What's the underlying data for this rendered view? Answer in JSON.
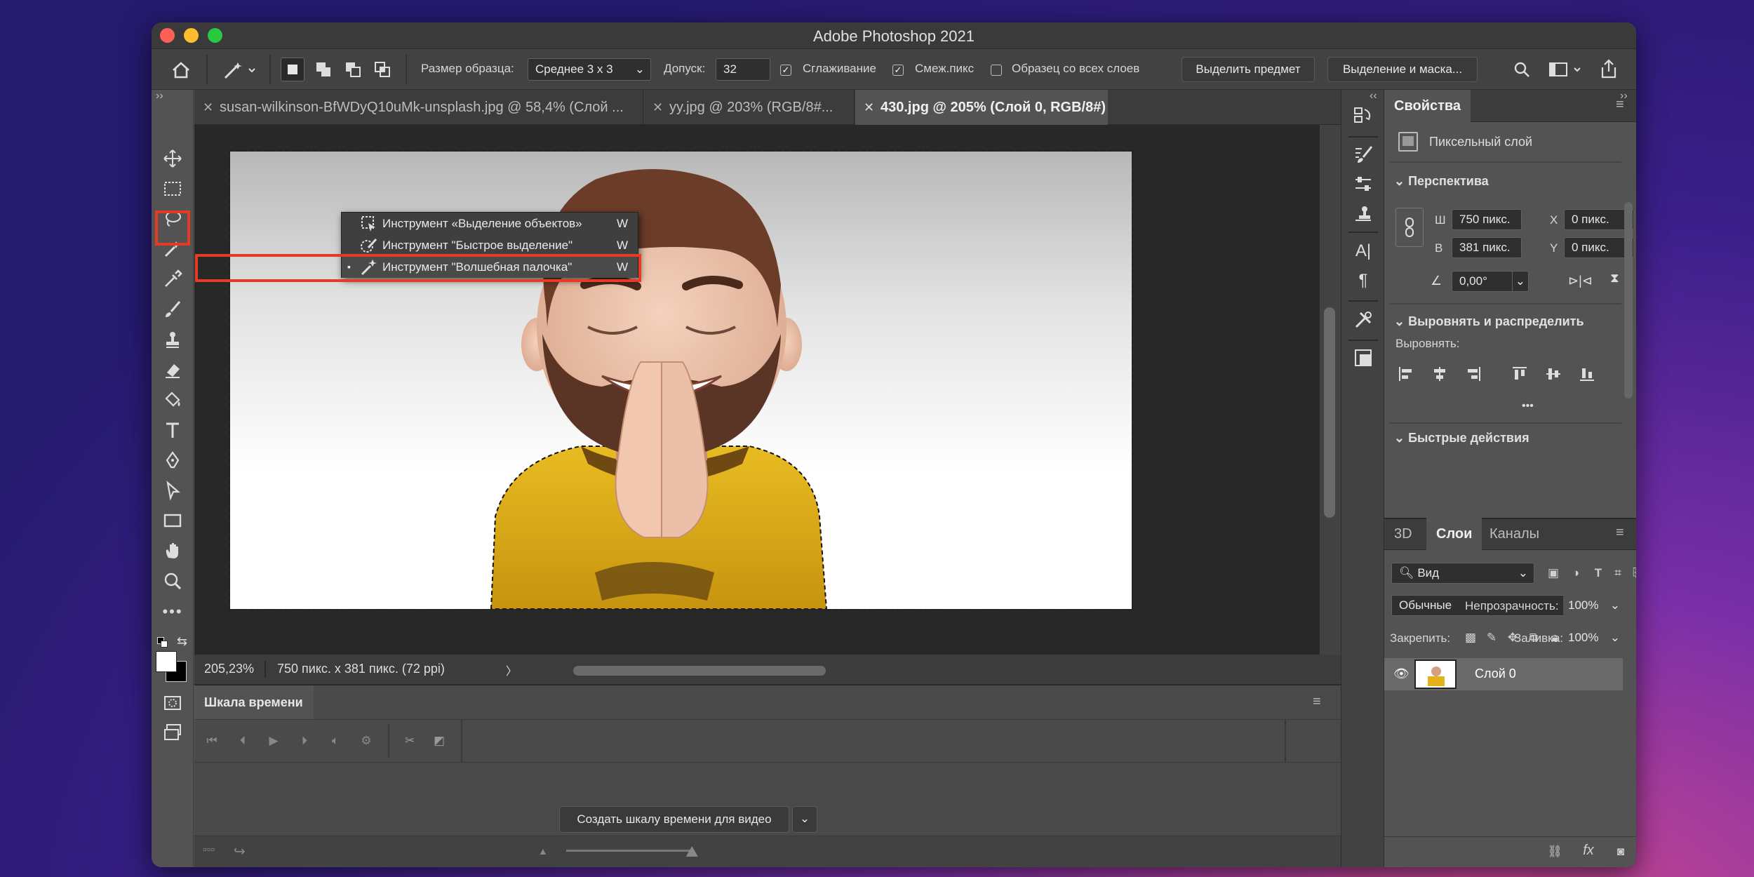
{
  "window": {
    "title": "Adobe Photoshop 2021"
  },
  "options_bar": {
    "sample_size_label": "Размер образца:",
    "sample_size_value": "Среднее 3 x 3",
    "tolerance_label": "Допуск:",
    "tolerance_value": "32",
    "anti_alias_label": "Сглаживание",
    "contiguous_label": "Смеж.пикс",
    "sample_all_label": "Образец со всех слоев",
    "select_subject": "Выделить предмет",
    "select_mask": "Выделение и маска..."
  },
  "tabs": [
    {
      "label": "susan-wilkinson-BfWDyQ10uMk-unsplash.jpg @ 58,4% (Слой ..."
    },
    {
      "label": "yy.jpg @ 203% (RGB/8#..."
    },
    {
      "label": "430.jpg @ 205% (Слой 0, RGB/8#) *"
    }
  ],
  "flyout": {
    "items": [
      {
        "label": "Инструмент «Выделение объектов»",
        "key": "W"
      },
      {
        "label": "Инструмент \"Быстрое выделение\"",
        "key": "W"
      },
      {
        "label": "Инструмент \"Волшебная палочка\"",
        "key": "W"
      }
    ]
  },
  "status": {
    "zoom": "205,23%",
    "doc_info": "750 пикс. x 381 пикс. (72 ppi)",
    "arrow": "〉"
  },
  "timeline": {
    "title": "Шкала времени",
    "create_button": "Создать шкалу времени для видео"
  },
  "properties": {
    "tab": "Свойства",
    "layer_type": "Пиксельный слой",
    "perspective": "Перспектива",
    "w_label": "Ш",
    "w_value": "750 пикс.",
    "h_label": "В",
    "h_value": "381 пикс.",
    "x_label": "X",
    "x_value": "0 пикс.",
    "y_label": "Y",
    "y_value": "0 пикс.",
    "angle_value": "0,00°",
    "align_section": "Выровнять и распределить",
    "align_label": "Выровнять:",
    "more": "•••",
    "quick_actions": "Быстрые действия"
  },
  "layers": {
    "tabs": [
      "3D",
      "Слои",
      "Каналы"
    ],
    "filter": "Вид",
    "blend_mode": "Обычные",
    "opacity_label": "Непрозрачность:",
    "opacity_value": "100%",
    "lock_label": "Закрепить:",
    "fill_label": "Заливка:",
    "fill_value": "100%",
    "layer_name": "Слой 0",
    "fx": "fx"
  },
  "colors": {
    "accent_red": "#e53b24",
    "panel": "#535353",
    "dark": "#282828",
    "shirt": "#e3b21a"
  }
}
